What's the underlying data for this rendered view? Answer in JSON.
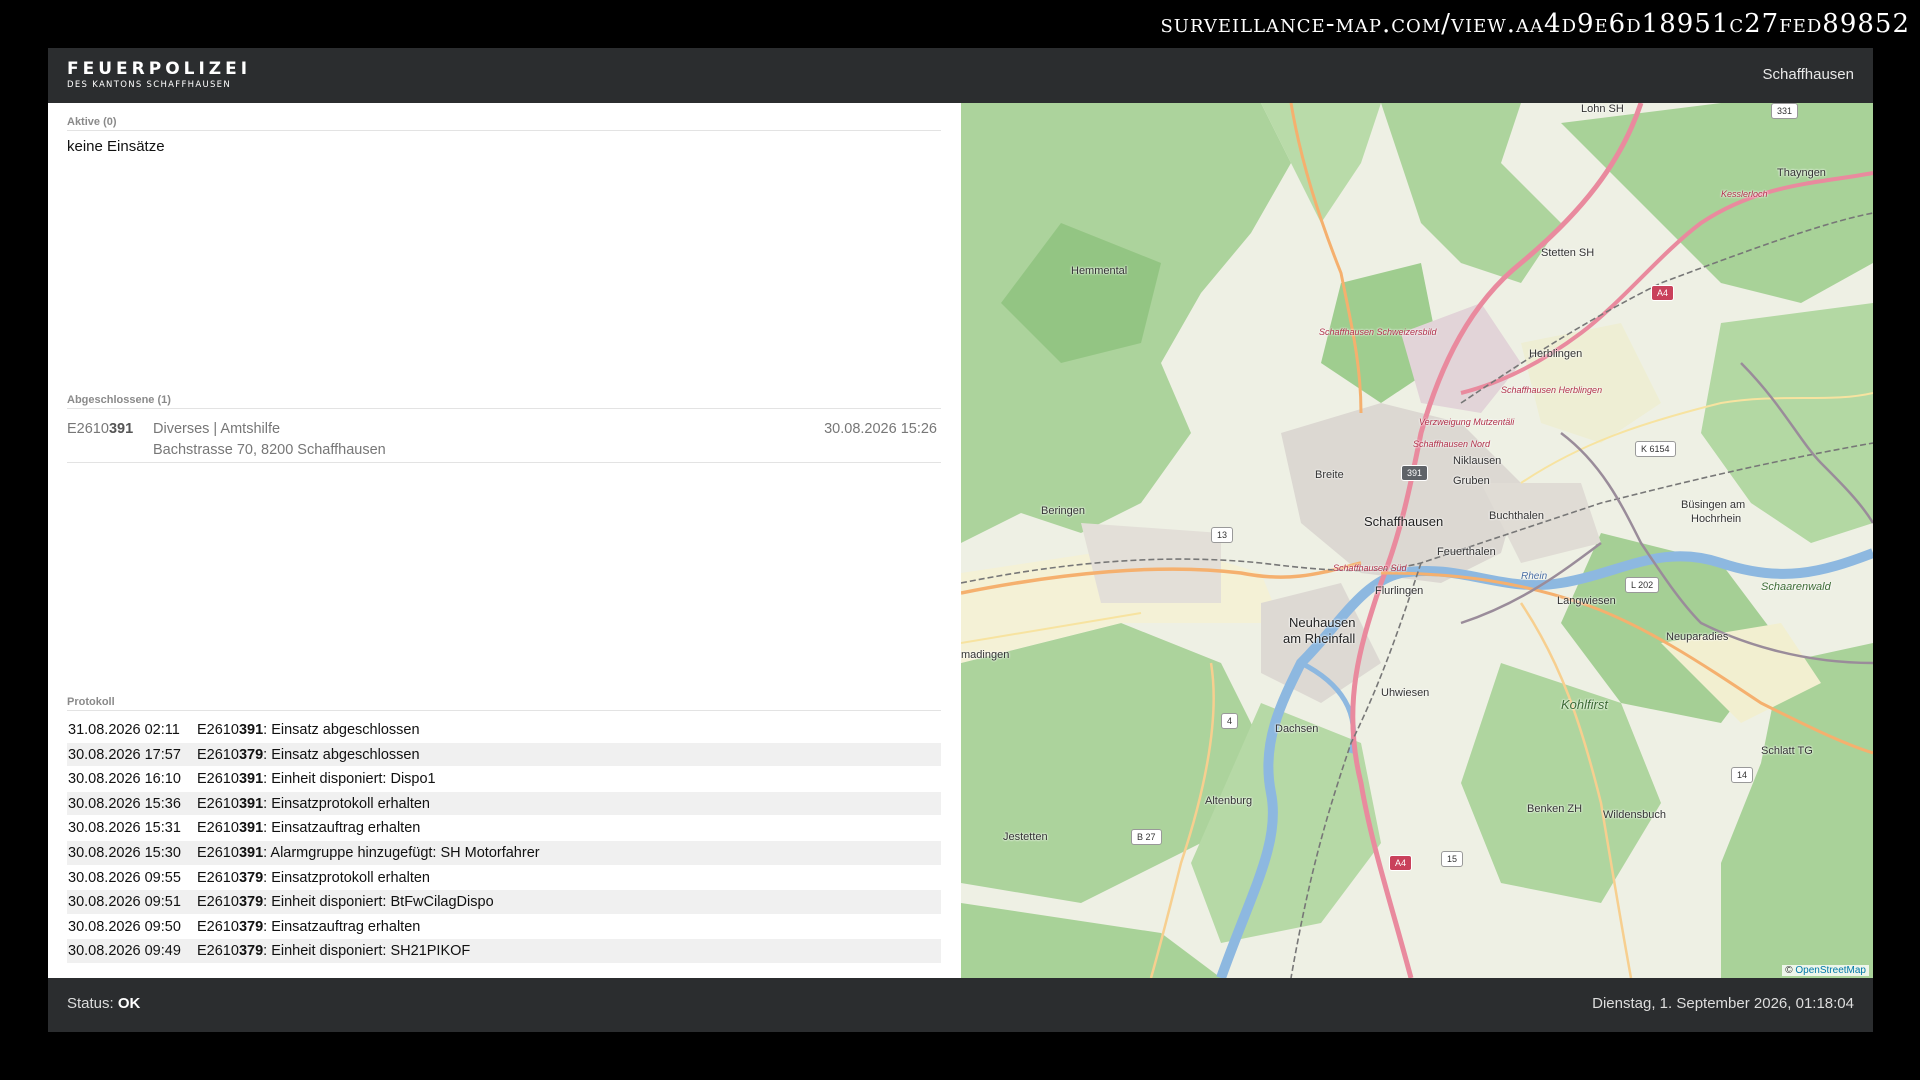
{
  "url_banner": "surveillance-map.com/view.aa4d9e6d18951c27fed89852",
  "header": {
    "logo_main": "FEUERPOLIZEI",
    "logo_sub": "DES KANTONS SCHAFFHAUSEN",
    "location": "Schaffhausen"
  },
  "active": {
    "title": "Aktive (0)",
    "empty_text": "keine Einsätze"
  },
  "closed": {
    "title": "Abgeschlossene (1)",
    "items": [
      {
        "id_prefix": "E2610",
        "id_suffix": "391",
        "type": "Diverses | Amtshilfe",
        "address": "Bachstrasse 70, 8200 Schaffhausen",
        "datetime": "30.08.2026 15:26"
      }
    ]
  },
  "log": {
    "title": "Protokoll",
    "rows": [
      {
        "time": "31.08.2026 02:11",
        "id_prefix": "E2610",
        "id_suffix": "391",
        "text": ": Einsatz abgeschlossen"
      },
      {
        "time": "30.08.2026 17:57",
        "id_prefix": "E2610",
        "id_suffix": "379",
        "text": ": Einsatz abgeschlossen"
      },
      {
        "time": "30.08.2026 16:10",
        "id_prefix": "E2610",
        "id_suffix": "391",
        "text": ": Einheit disponiert: Dispo1"
      },
      {
        "time": "30.08.2026 15:36",
        "id_prefix": "E2610",
        "id_suffix": "391",
        "text": ": Einsatzprotokoll erhalten"
      },
      {
        "time": "30.08.2026 15:31",
        "id_prefix": "E2610",
        "id_suffix": "391",
        "text": ": Einsatzauftrag erhalten"
      },
      {
        "time": "30.08.2026 15:30",
        "id_prefix": "E2610",
        "id_suffix": "391",
        "text": ": Alarmgruppe hinzugefügt: SH Motorfahrer"
      },
      {
        "time": "30.08.2026 09:55",
        "id_prefix": "E2610",
        "id_suffix": "379",
        "text": ": Einsatzprotokoll erhalten"
      },
      {
        "time": "30.08.2026 09:51",
        "id_prefix": "E2610",
        "id_suffix": "379",
        "text": ": Einheit disponiert: BtFwCilagDispo"
      },
      {
        "time": "30.08.2026 09:50",
        "id_prefix": "E2610",
        "id_suffix": "379",
        "text": ": Einsatzauftrag erhalten"
      },
      {
        "time": "30.08.2026 09:49",
        "id_prefix": "E2610",
        "id_suffix": "379",
        "text": ": Einheit disponiert: SH21PIKOF"
      }
    ]
  },
  "map": {
    "attribution_prefix": "© ",
    "attribution_link": "OpenStreetMap",
    "labels": {
      "schaffhausen": "Schaffhausen",
      "herblingen": "Herblingen",
      "breite": "Breite",
      "niklausen": "Niklausen",
      "gruben": "Gruben",
      "buchthalen": "Buchthalen",
      "feuerthalen": "Feuerthalen",
      "flurlingen": "Flurlingen",
      "neuhausen": "Neuhausen",
      "am_rheinfall": "am Rheinfall",
      "beringen": "Beringen",
      "hemmental": "Hemmental",
      "stetten": "Stetten SH",
      "thayngen": "Thayngen",
      "lohn": "Lohn SH",
      "busingen": "Büsingen am",
      "hochrhein": "Hochrhein",
      "langwiesen": "Langwiesen",
      "uhwiesen": "Uhwiesen",
      "dachsen": "Dachsen",
      "altenburg": "Altenburg",
      "jestetten": "Jestetten",
      "benken": "Benken ZH",
      "wildensbuch": "Wildensbuch",
      "schlatt": "Schlatt TG",
      "neuparadies": "Neuparadies",
      "kohlfirst": "Kohlfirst",
      "schaarenwald": "Schaarenwald",
      "gailingen": "madingen",
      "road_sh_nord": "Schaffhausen Nord",
      "road_sh_herblingen": "Schaffhausen Herblingen",
      "road_mutzental": "Verzweigung Mutzentäli",
      "road_sh_schweizersbild": "Schaffhausen Schweizersbild",
      "road_sh_sud": "Schaffhausen Süd",
      "road_kesslerloch": "Kesslerloch",
      "water_rhein": "Rhein",
      "shield_a4": "A4",
      "shield_391": "391",
      "shield_13": "13",
      "shield_15": "15",
      "shield_14": "14",
      "shield_4": "4",
      "shield_b27": "B 27",
      "shield_k6154": "K 6154",
      "shield_l202": "L 202",
      "shield_331": "331"
    }
  },
  "footer": {
    "status_label": "Status: ",
    "status_value": "OK",
    "datetime": "Dienstag, 1. September 2026, 01:18:04"
  }
}
